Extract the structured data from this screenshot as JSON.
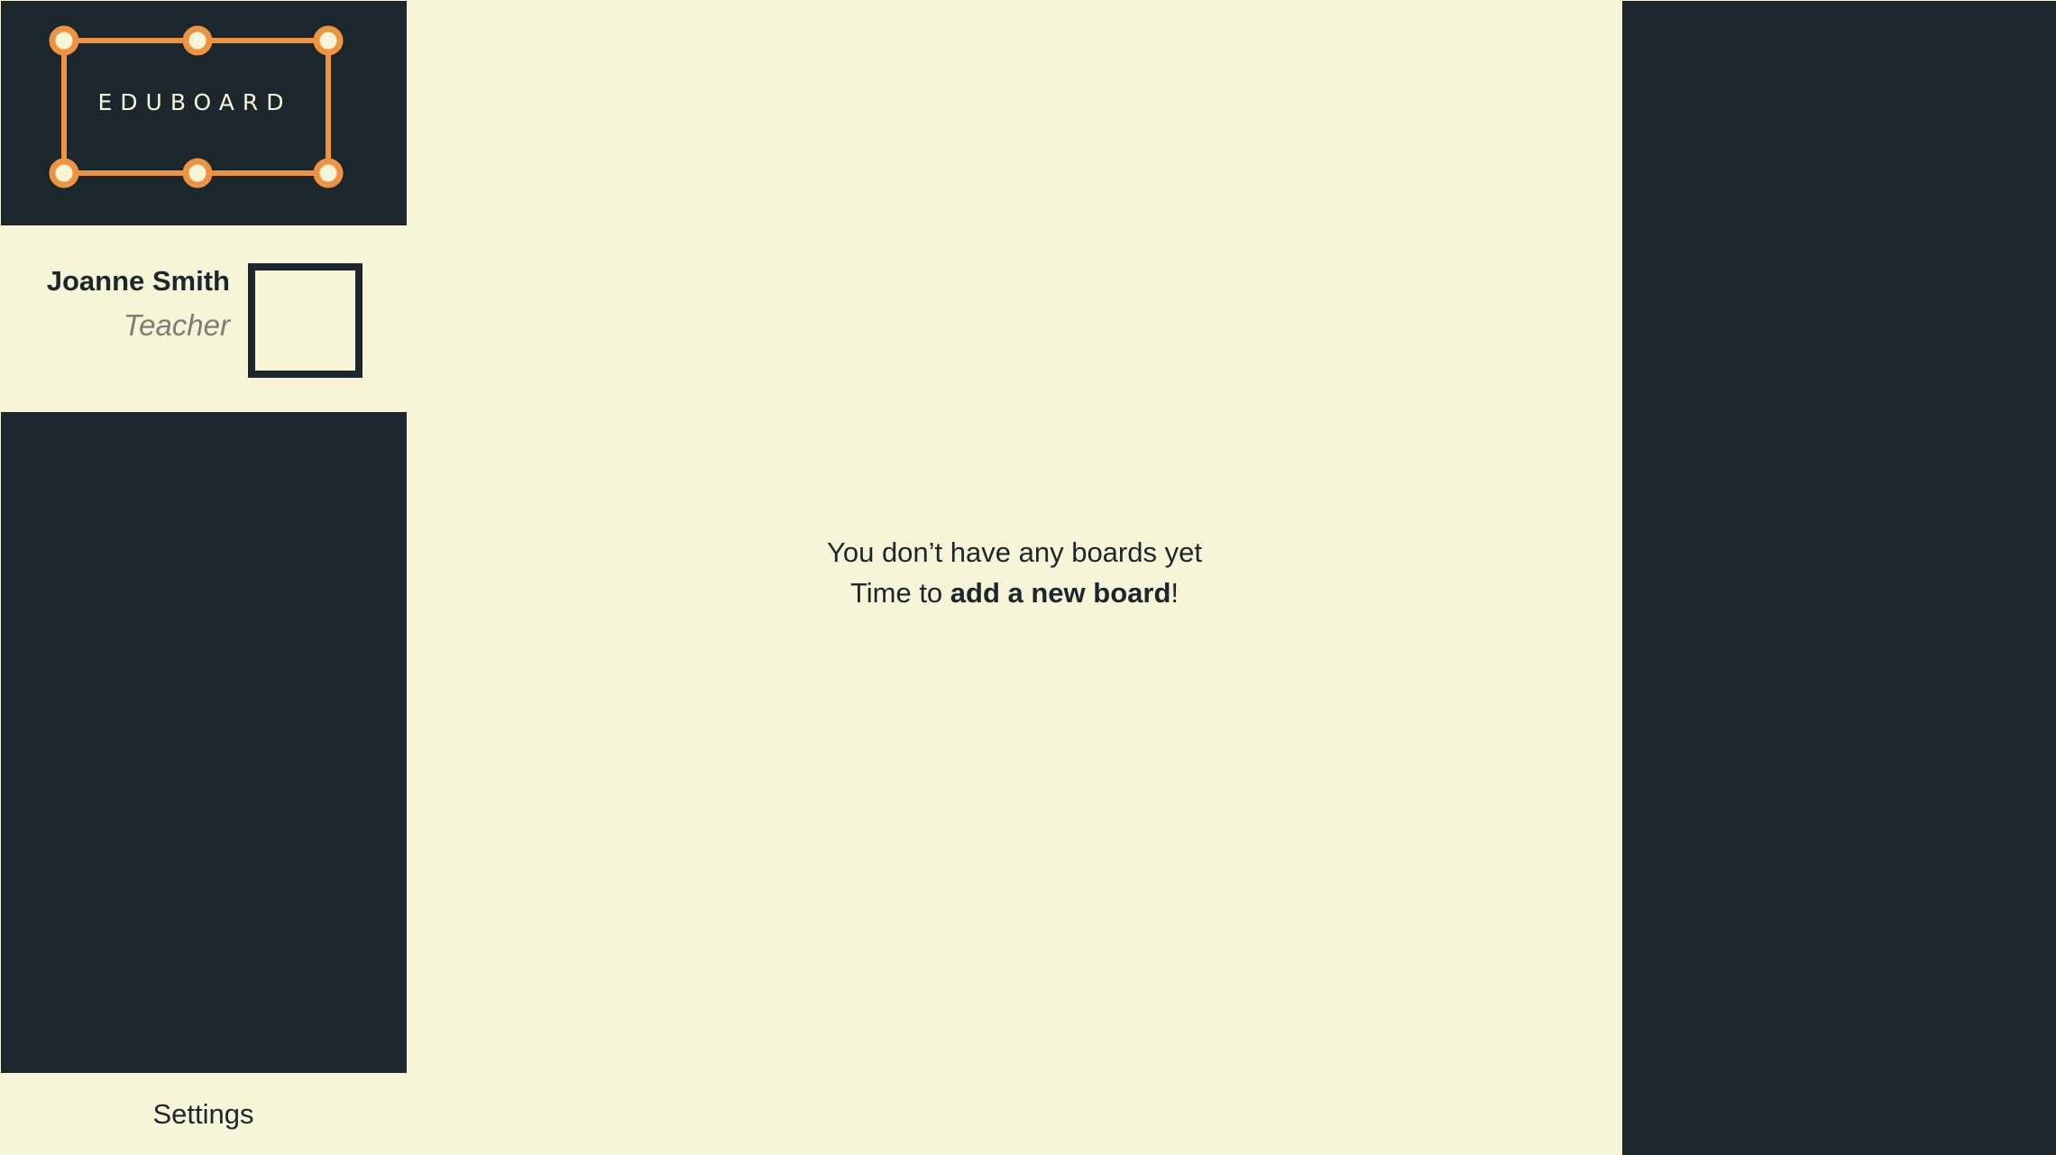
{
  "app": {
    "logo_text": "EDUBOARD",
    "colors": {
      "dark": "#1b272d",
      "cream": "#f7f5d7",
      "accent": "#ee9441"
    }
  },
  "profile": {
    "name": "Joanne Smith",
    "role": "Teacher",
    "avatar_icon": "avatar-placeholder"
  },
  "main": {
    "empty_line1": "You don’t have any boards yet",
    "empty_line2_prefix": "Time to ",
    "empty_line2_link": "add a new board",
    "empty_line2_suffix": "!"
  },
  "sidebar": {
    "settings_label": "Settings"
  }
}
